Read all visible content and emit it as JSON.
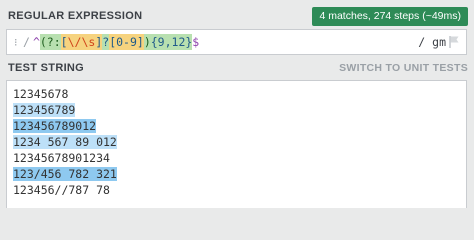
{
  "regex_section": {
    "title": "REGULAR EXPRESSION",
    "badge": "4 matches, 274 steps (~49ms)",
    "open_delim": "/",
    "tokens": {
      "anchor_start": "^",
      "group_open": "(?:",
      "class_open": "[",
      "esc1": "\\/",
      "esc2": "\\s",
      "class_close": "]",
      "optional": "?",
      "range": "[0-9]",
      "group_close": ")",
      "quant": "{9,12}",
      "anchor_end": "$"
    },
    "flags": "/ gm"
  },
  "test_section": {
    "title": "TEST STRING",
    "switch_label": "SWITCH TO UNIT TESTS",
    "lines": [
      {
        "text": "12345678",
        "match": ""
      },
      {
        "text": "123456789",
        "match": "a"
      },
      {
        "text": "123456789012",
        "match": "b"
      },
      {
        "text": "1234 567 89 012",
        "match": "a"
      },
      {
        "text": "12345678901234",
        "match": ""
      },
      {
        "text": "123/456 782 321",
        "match": "b"
      },
      {
        "text": "123456//787 78",
        "match": ""
      }
    ]
  },
  "colors": {
    "badge": "#2e8b57",
    "match_light": "#bde0f8",
    "match_dark": "#8ec9f0"
  },
  "icons": [
    "flag-icon"
  ]
}
